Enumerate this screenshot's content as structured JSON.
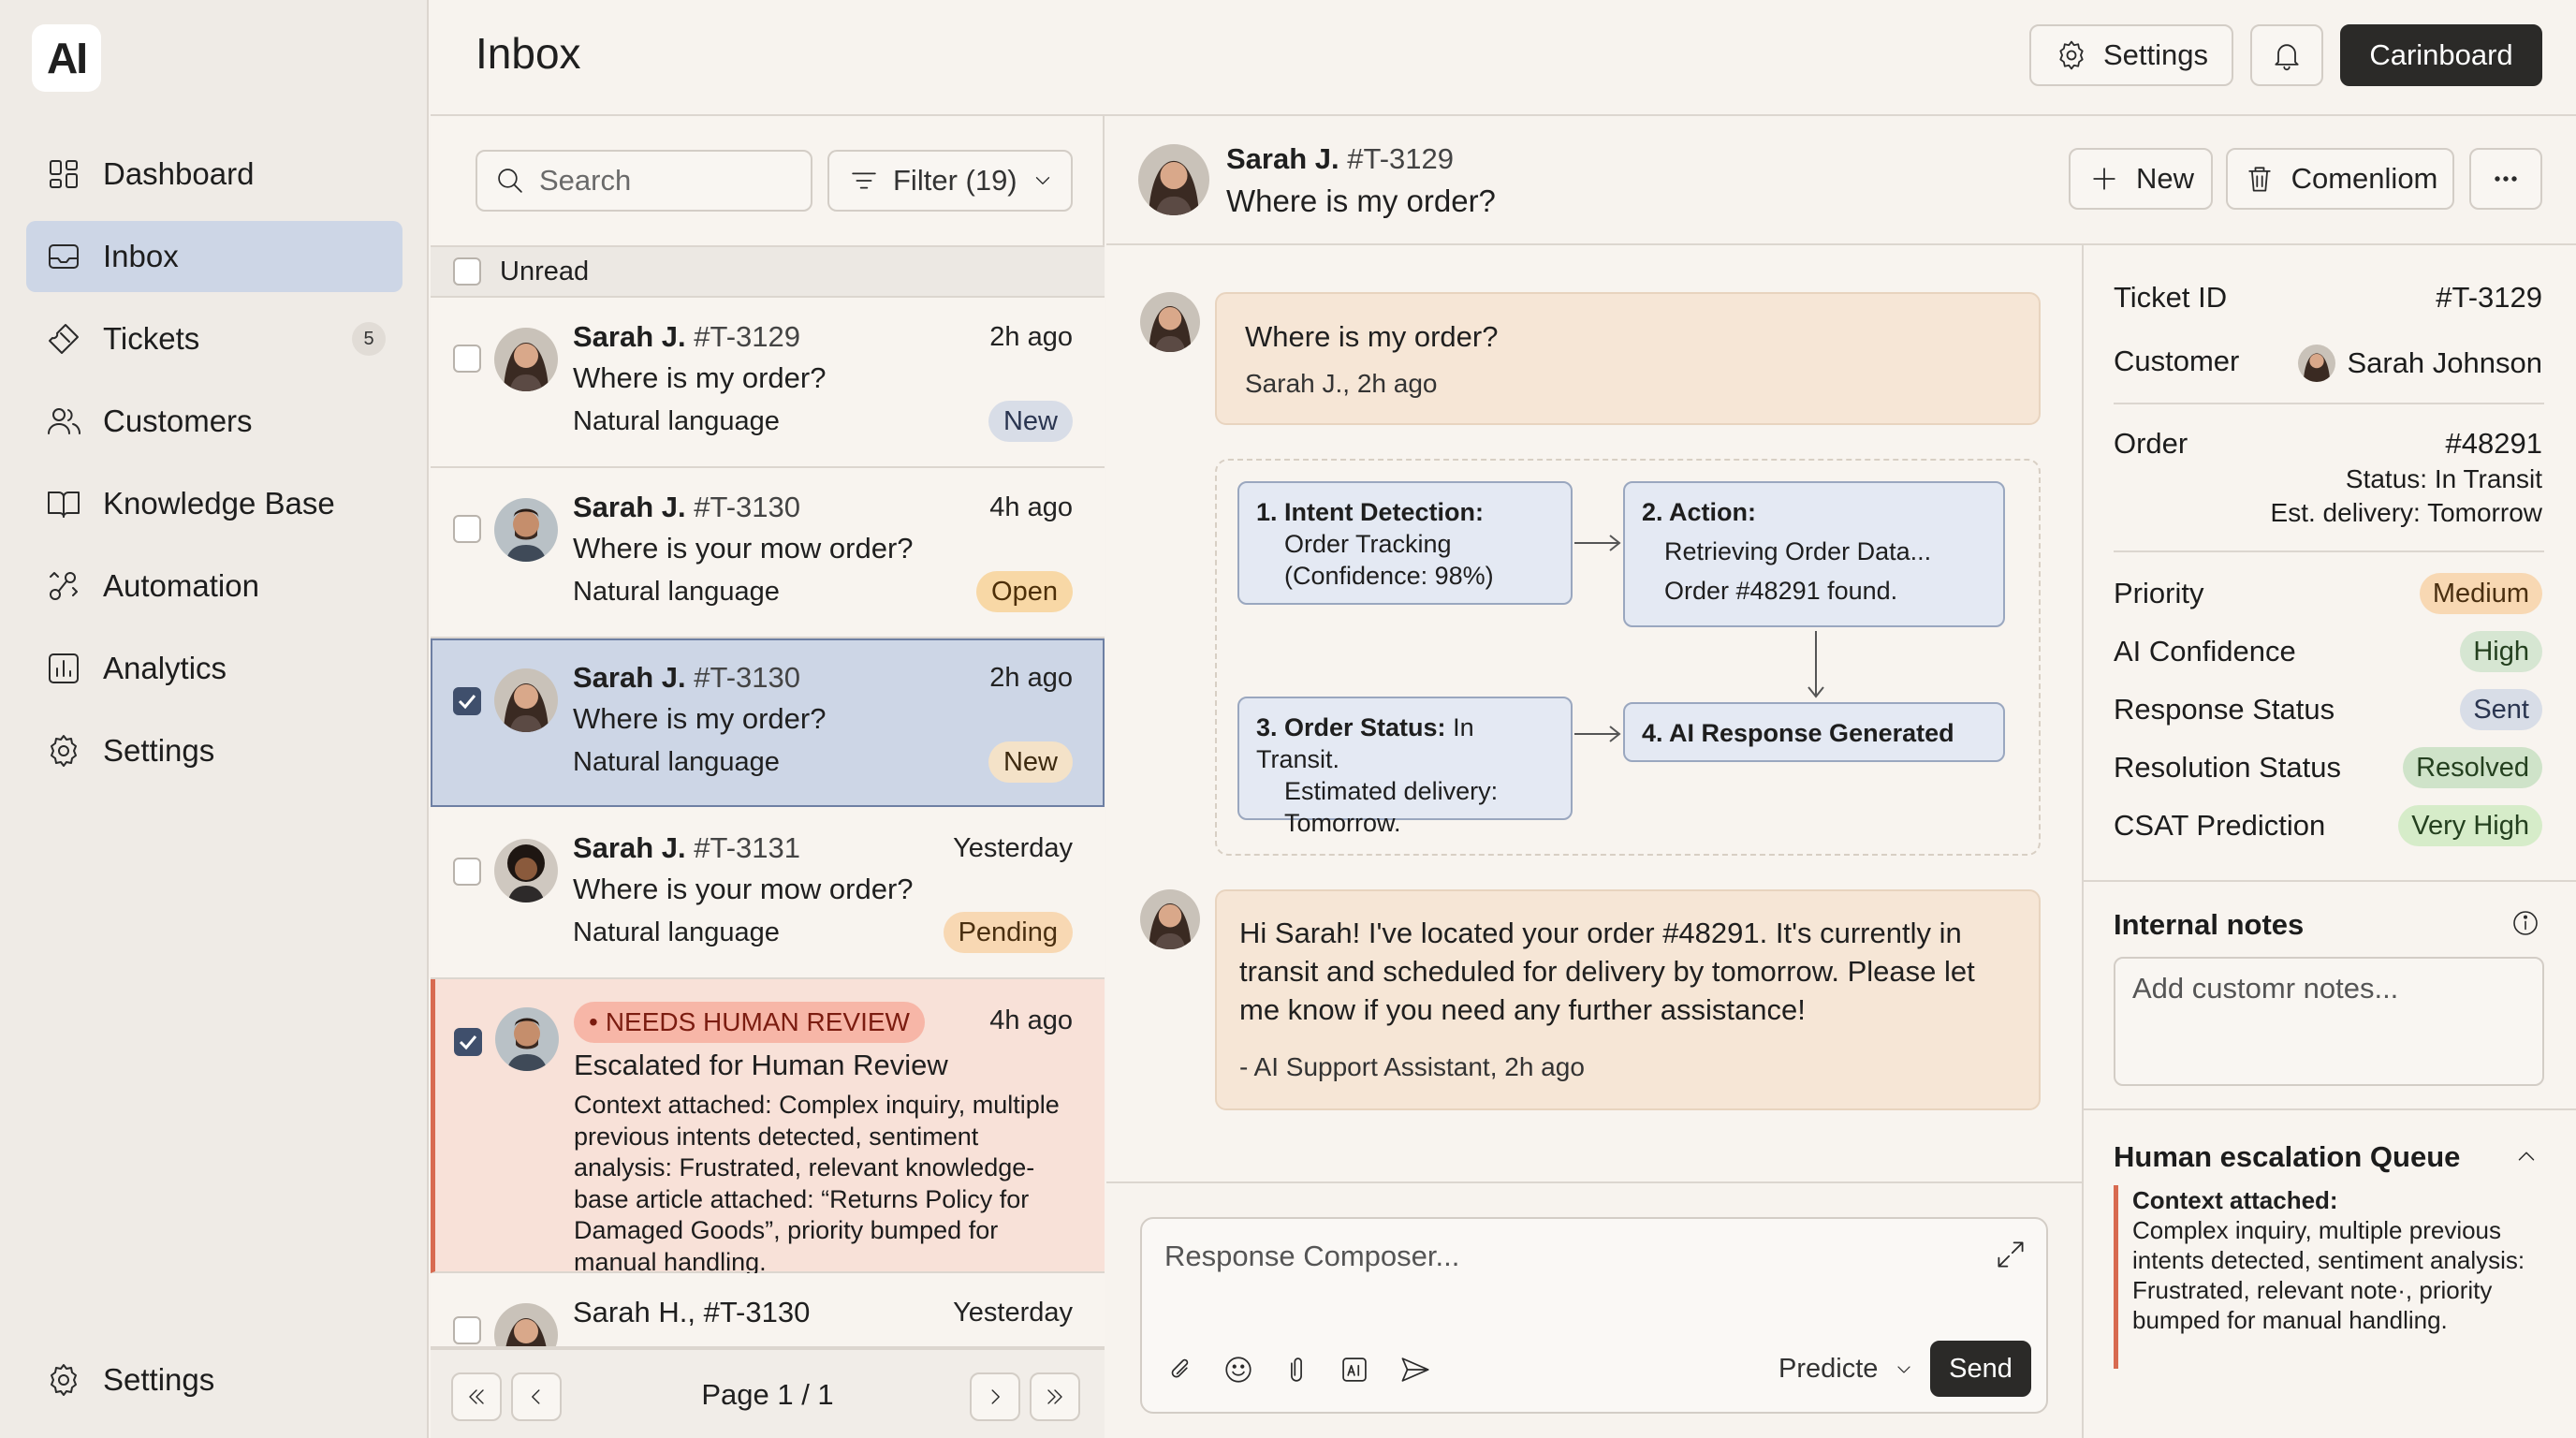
{
  "app": {
    "logo": "AI"
  },
  "sidebar": {
    "items": [
      {
        "label": "Dashboard",
        "icon": "grid-icon"
      },
      {
        "label": "Inbox",
        "icon": "inbox-icon",
        "active": true
      },
      {
        "label": "Tickets",
        "icon": "ticket-icon",
        "badge": "5"
      },
      {
        "label": "Customers",
        "icon": "users-icon"
      },
      {
        "label": "Knowledge Base",
        "icon": "book-icon"
      },
      {
        "label": "Automation",
        "icon": "automation-icon"
      },
      {
        "label": "Analytics",
        "icon": "chart-icon"
      },
      {
        "label": "Settings",
        "icon": "gear-icon"
      }
    ],
    "footer_settings": "Settings"
  },
  "header": {
    "title": "Inbox",
    "settings_label": "Settings",
    "dashboard_label": "Carinboard"
  },
  "list": {
    "search_placeholder": "Search",
    "filter_label": "Filter (19)",
    "unread_label": "Unread",
    "items": [
      {
        "name": "Sarah J.",
        "ticket": "#T-3129",
        "time": "2h ago",
        "subject": "Where is my order?",
        "kind": "Natural language",
        "status": "New"
      },
      {
        "name": "Sarah J.",
        "ticket": "#T-3130",
        "time": "4h ago",
        "subject": "Where is your mow order?",
        "kind": "Natural language",
        "status": "Open"
      },
      {
        "name": "Sarah J.",
        "ticket": "#T-3130",
        "time": "2h ago",
        "subject": "Where is my order?",
        "kind": "Natural language",
        "status": "New"
      },
      {
        "name": "Sarah J.",
        "ticket": "#T-3131",
        "time": "Yesterday",
        "subject": "Where is your mow order?",
        "kind": "Natural language",
        "status": "Pending"
      },
      {
        "badge": "NEEDS HUMAN REVIEW",
        "time": "4h ago",
        "subject": "Escalated for Human Review",
        "context": "Context attached: Complex inquiry, multiple previous intents detected, sentiment analysis: Frustrated, relevant knowledge-base article attached: “Returns Policy for Damaged Goods”, priority bumped for manual handling."
      },
      {
        "name": "Sarah H.,",
        "ticket": "#T-3130",
        "time": "Yesterday"
      }
    ],
    "pager": "Page 1 / 1"
  },
  "conversation": {
    "customer": "Sarah J.",
    "ticket": "#T-3129",
    "subject": "Where is my order?",
    "new_label": "New",
    "action_label": "Comenliom",
    "message": {
      "text": "Where is my order?",
      "meta": "Sarah J., 2h ago"
    },
    "flow": {
      "step1_title": "1. Intent Detection:",
      "step1_body": [
        "Order Tracking",
        "(Confidence: 98%)"
      ],
      "step2_title": "2. Action:",
      "step2_body": [
        "Retrieving Order Data...",
        "Order #48291 found."
      ],
      "step3_title": "3. Order Status:",
      "step3_title_rest": "In Transit.",
      "step3_body": [
        "Estimated delivery:",
        "Tomorrow."
      ],
      "step4_title": "4. AI Response Generated"
    },
    "reply": {
      "text": "Hi Sarah! I've located your order #48291. It's currently in transit and scheduled for delivery by tomorrow. Please let me know if you need any further assistance!",
      "meta": "- AI Support Assistant, 2h ago"
    },
    "composer": {
      "placeholder": "Response Composer...",
      "predict_label": "Predicte",
      "send_label": "Send"
    }
  },
  "details": {
    "ticket_id_label": "Ticket ID",
    "ticket_id": "#T-3129",
    "customer_label": "Customer",
    "customer": "Sarah Johnson",
    "order_label": "Order",
    "order": "#48291",
    "order_status": "Status: In Transit",
    "order_delivery": "Est. delivery: Tomorrow",
    "priority_label": "Priority",
    "priority": "Medium",
    "confidence_label": "AI Confidence",
    "confidence": "High",
    "response_label": "Response Status",
    "response": "Sent",
    "resolution_label": "Resolution Status",
    "resolution": "Resolved",
    "csat_label": "CSAT Prediction",
    "csat": "Very High",
    "notes_title": "Internal notes",
    "notes_placeholder": "Add customr notes...",
    "queue_title": "Human escalation Queue",
    "queue_context_title": "Context attached:",
    "queue_context": "Complex inquiry, multiple previous intents detected, sentiment analysis: Frustrated, relevant note·, priority bumped for manual handling."
  },
  "colors": {
    "accent_selected": "#cdd6e6",
    "review_bg": "#f8e1d8",
    "review_border": "#d86a50",
    "dark_button": "#2b2a28"
  }
}
